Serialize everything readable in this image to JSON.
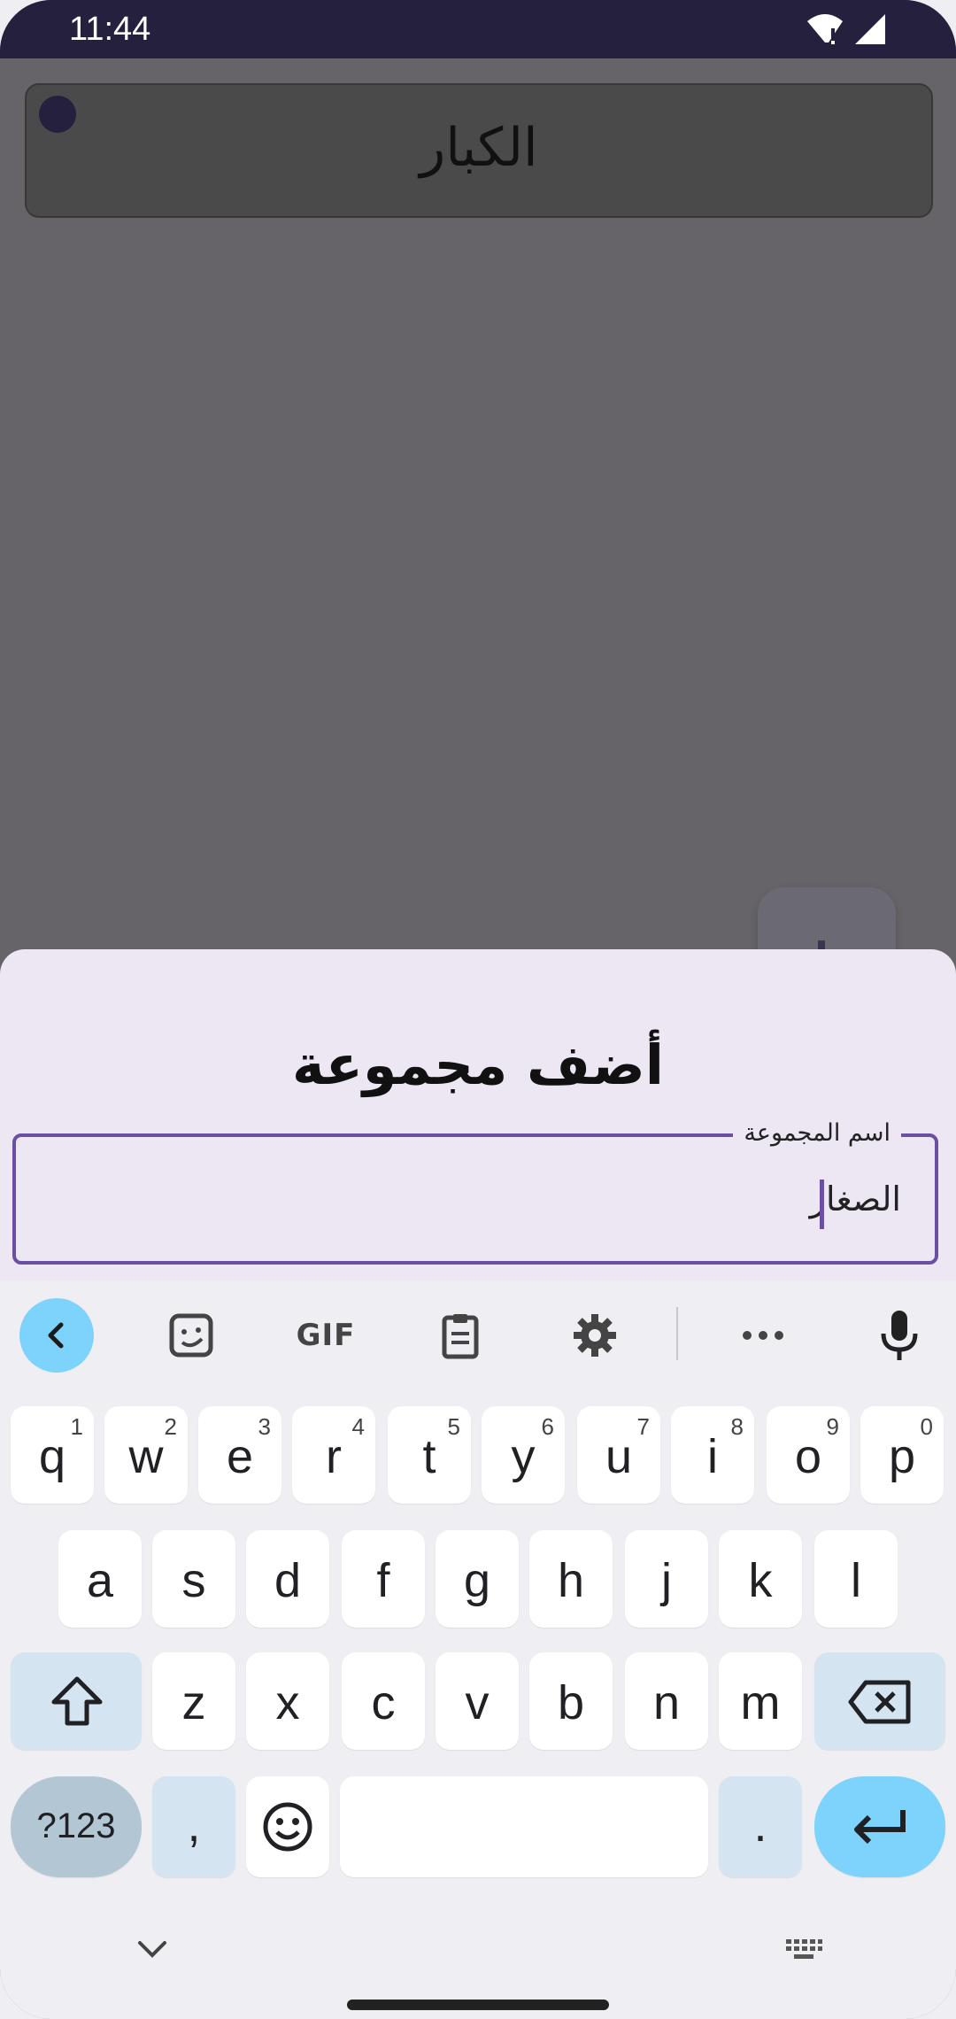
{
  "status_bar": {
    "time": "11:44",
    "icons": [
      "wifi-alert-icon",
      "signal-icon"
    ]
  },
  "group_list": {
    "items": [
      {
        "name": "الكبار"
      }
    ]
  },
  "fab": {
    "icon": "plus-icon"
  },
  "sheet": {
    "title": "أضف مجموعة",
    "field": {
      "label": "اسم المجموعة",
      "value": "الصغار"
    }
  },
  "keyboard": {
    "toolbar": {
      "gif_label": "GIF"
    },
    "rows": [
      [
        {
          "ch": "q",
          "hint": "1"
        },
        {
          "ch": "w",
          "hint": "2"
        },
        {
          "ch": "e",
          "hint": "3"
        },
        {
          "ch": "r",
          "hint": "4"
        },
        {
          "ch": "t",
          "hint": "5"
        },
        {
          "ch": "y",
          "hint": "6"
        },
        {
          "ch": "u",
          "hint": "7"
        },
        {
          "ch": "i",
          "hint": "8"
        },
        {
          "ch": "o",
          "hint": "9"
        },
        {
          "ch": "p",
          "hint": "0"
        }
      ],
      [
        {
          "ch": "a"
        },
        {
          "ch": "s"
        },
        {
          "ch": "d"
        },
        {
          "ch": "f"
        },
        {
          "ch": "g"
        },
        {
          "ch": "h"
        },
        {
          "ch": "j"
        },
        {
          "ch": "k"
        },
        {
          "ch": "l"
        }
      ],
      [
        {
          "ch": "z"
        },
        {
          "ch": "x"
        },
        {
          "ch": "c"
        },
        {
          "ch": "v"
        },
        {
          "ch": "b"
        },
        {
          "ch": "n"
        },
        {
          "ch": "m"
        }
      ]
    ],
    "symbols_label": "?123",
    "comma_label": ",",
    "period_label": "."
  },
  "colors": {
    "accent": "#6a4fa2",
    "status_bar": "#26203f",
    "key_blue": "#7dd3fb"
  }
}
